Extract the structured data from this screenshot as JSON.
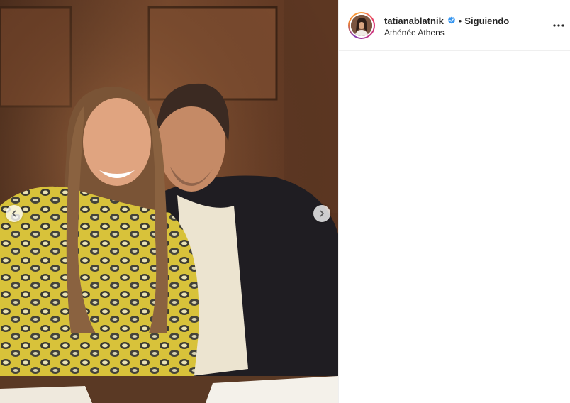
{
  "post": {
    "image_alt": "",
    "prev_icon": "chevron-left-icon",
    "next_icon": "chevron-right-icon"
  },
  "header": {
    "username": "tatianablatnik",
    "verified_icon": "verified-badge-icon",
    "separator": "•",
    "follow_status": "Siguiendo",
    "location": "Athénée Athens",
    "more_icon": "more-options-icon"
  },
  "colors": {
    "verified": "#3897f0",
    "text": "#262626",
    "divider": "#efefef"
  }
}
